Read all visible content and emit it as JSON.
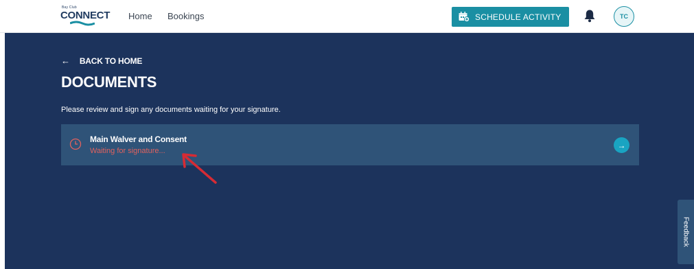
{
  "header": {
    "logo_small": "Bay Club",
    "logo_text": "CONNECT",
    "nav": {
      "home": "Home",
      "bookings": "Bookings"
    },
    "schedule_label": "SCHEDULE ACTIVITY",
    "avatar_initials": "TC",
    "icons": {
      "schedule": "calendar-plus-icon",
      "notifications": "bell-icon"
    }
  },
  "main": {
    "back_label": "BACK TO HOME",
    "back_arrow": "←",
    "title": "DOCUMENTS",
    "intro": "Please review and sign any documents waiting for your signature.",
    "documents": [
      {
        "title": "Main Walver and Consent",
        "status": "Waiting for signature...",
        "status_icon": "clock-icon",
        "action_icon": "arrow-right-icon"
      }
    ]
  },
  "feedback_label": "Feedback",
  "colors": {
    "main_bg": "#1c335c",
    "card_bg": "#2f5378",
    "accent": "#1a8fa3",
    "status_warning": "#e2625e",
    "go_button": "#19a4c2",
    "annotation": "#d62b34"
  }
}
